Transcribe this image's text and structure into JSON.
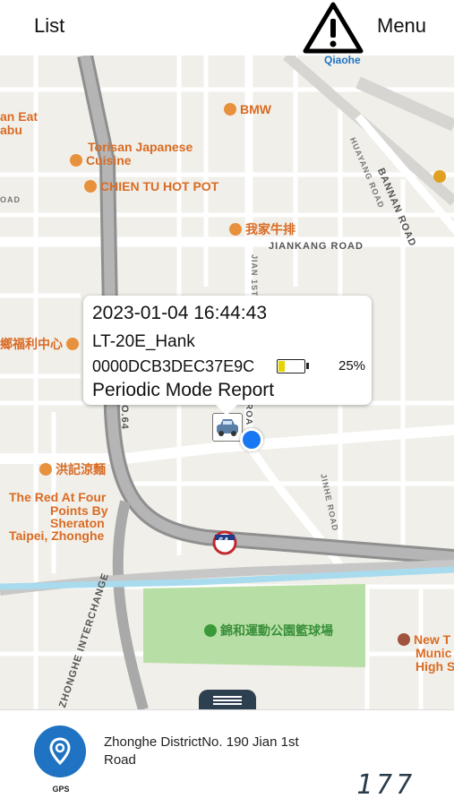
{
  "topbar": {
    "left_label": "List",
    "right_label": "Menu",
    "warning_icon": "warning-triangle-icon"
  },
  "map": {
    "poi": {
      "qiaohe": "Qiaohe",
      "bmw": "BMW",
      "an_eat": "an Eat",
      "abu": "abu",
      "torisan_1": "Torisan Japanese",
      "torisan_2": "Cuisine",
      "chien_tu": "CHIEN TU HOT POT",
      "wojia": "我家牛排",
      "fuli": "鄉福利中心",
      "hongji": "洪記涼麵",
      "sheraton_1": "The Red At Four",
      "sheraton_2": "Points By",
      "sheraton_3": "Sheraton",
      "sheraton_4": "Taipei, Zhonghe",
      "park": "錦和運動公園籃球場",
      "newt_1": "New T",
      "newt_2": "Munic",
      "newt_3": "High S"
    },
    "roads": {
      "jiankang": "JIANKANG ROAD",
      "bannan": "BANNAN ROAD",
      "huayang": "HUAYANG ROAD",
      "jinhe": "JINHE ROAD",
      "jian1st": "JIAN 1ST",
      "road_short": "ROA",
      "oad": "OAD",
      "exp64": "O.64",
      "interchange": "ZHONGHE INTERCHANGE",
      "shield": "64"
    }
  },
  "popup": {
    "datetime": "2023-01-04 16:44:43",
    "device": "LT-20E_Hank",
    "device_id": "0000DCB3DEC37E9C",
    "battery_text": "25%",
    "battery_level": 0.25,
    "report_type": "Periodic Mode Report"
  },
  "bottom": {
    "gps_label": "GPS",
    "address": "Zhonghe DistrictNo. 190 Jian 1st Road",
    "counter": "177"
  },
  "colors": {
    "accent": "#1f73c2",
    "poi": "#d96b23",
    "location": "#1877f2"
  }
}
